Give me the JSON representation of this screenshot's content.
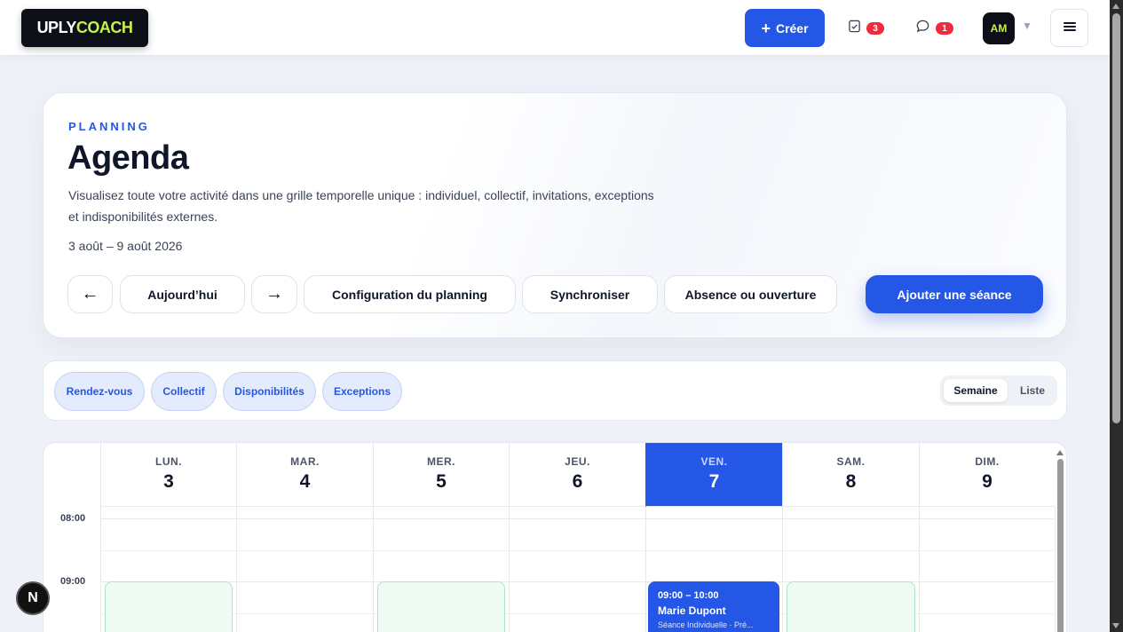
{
  "header": {
    "logo": {
      "part1": "UPLY",
      "part2": "COACH"
    },
    "create_label": "Créer",
    "tasks_badge": "3",
    "messages_badge": "1",
    "avatar_initials": "AM"
  },
  "hero": {
    "eyebrow": "PLANNING",
    "title": "Agenda",
    "description": "Visualisez toute votre activité dans une grille temporelle unique : individuel, collectif, invitations, exceptions et indisponibilités externes.",
    "date_range": "3 août – 9 août 2026",
    "buttons": {
      "prev": "←",
      "today": "Aujourd’hui",
      "next": "→",
      "config": "Configuration du planning",
      "sync": "Synchroniser",
      "absence": "Absence ou ouverture",
      "add": "Ajouter une séance"
    }
  },
  "filters": {
    "chips": [
      "Rendez-vous",
      "Collectif",
      "Disponibilités",
      "Exceptions"
    ],
    "view_active": "Semaine",
    "view_other": "Liste"
  },
  "calendar": {
    "days": [
      {
        "name": "LUN.",
        "num": "3"
      },
      {
        "name": "MAR.",
        "num": "4"
      },
      {
        "name": "MER.",
        "num": "5"
      },
      {
        "name": "JEU.",
        "num": "6"
      },
      {
        "name": "VEN.",
        "num": "7",
        "today": true
      },
      {
        "name": "SAM.",
        "num": "8"
      },
      {
        "name": "DIM.",
        "num": "9"
      }
    ],
    "hours": [
      "08:00",
      "09:00"
    ],
    "event": {
      "time": "09:00 – 10:00",
      "client": "Marie Dupont",
      "type": "Séance Individuelle · Pré..."
    }
  },
  "dev": {
    "indicator": "N"
  },
  "colors": {
    "accent": "#2557e6",
    "brand_lime": "#c6f24b",
    "badge": "#ef2b3c",
    "availability": "#f0fbf5"
  }
}
